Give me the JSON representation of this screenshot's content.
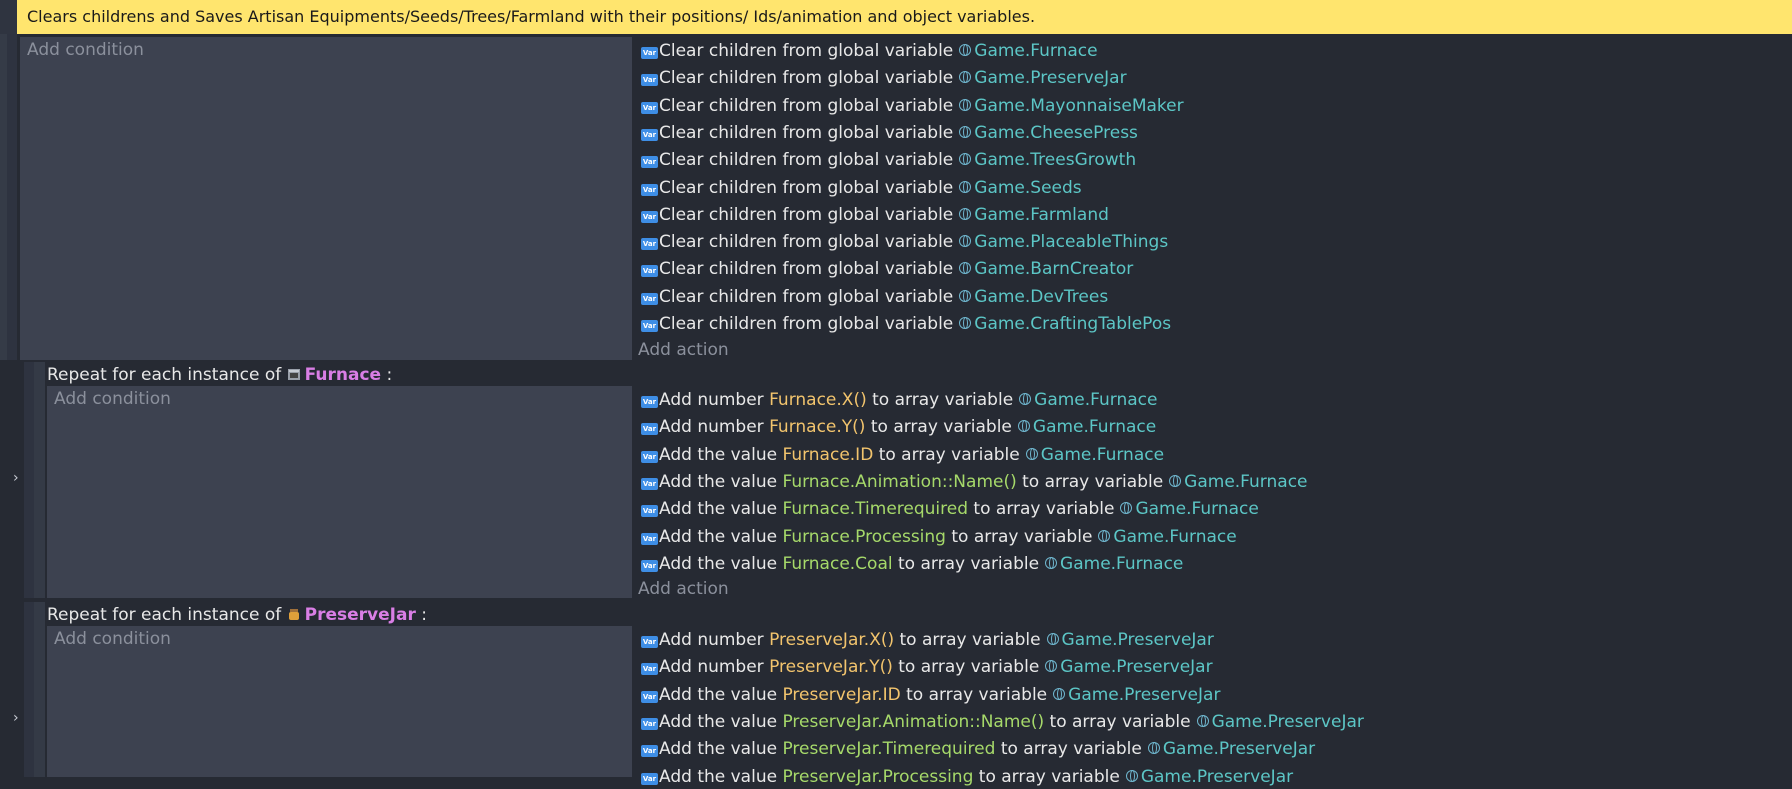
{
  "comment": "Clears childrens and Saves Artisan  Equipments/Seeds/Trees/Farmland with their positions/ Ids/animation and object variables.",
  "add_condition": "Add condition",
  "add_action": "Add action",
  "clear_prefix": "Clear children from global variable",
  "var_icon_text": "Var",
  "clear_actions": [
    "Game.Furnace",
    "Game.PreserveJar",
    "Game.MayonnaiseMaker",
    "Game.CheesePress",
    "Game.TreesGrowth",
    "Game.Seeds",
    "Game.Farmland",
    "Game.PlaceableThings",
    "Game.BarnCreator",
    "Game.DevTrees",
    "Game.CraftingTablePos"
  ],
  "repeat_prefix": "Repeat for each instance of",
  "repeat_suffix": ":",
  "to_array": "to array variable",
  "add_number": "Add number",
  "add_value": "Add the value",
  "furnace": {
    "object": "Furnace",
    "target": "Game.Furnace",
    "actions": [
      {
        "verb": "Add number",
        "expr": "Furnace.X()",
        "kind": "y"
      },
      {
        "verb": "Add number",
        "expr": "Furnace.Y()",
        "kind": "y"
      },
      {
        "verb": "Add the value",
        "expr": "Furnace.ID",
        "kind": "y"
      },
      {
        "verb": "Add the value",
        "expr": "Furnace.Animation::Name()",
        "kind": "g"
      },
      {
        "verb": "Add the value",
        "expr": "Furnace.Timerequired",
        "kind": "g"
      },
      {
        "verb": "Add the value",
        "expr": "Furnace.Processing",
        "kind": "g"
      },
      {
        "verb": "Add the value",
        "expr": "Furnace.Coal",
        "kind": "g"
      }
    ]
  },
  "preservejar": {
    "object": "PreserveJar",
    "target": "Game.PreserveJar",
    "actions": [
      {
        "verb": "Add number",
        "expr": "PreserveJar.X()",
        "kind": "y"
      },
      {
        "verb": "Add number",
        "expr": "PreserveJar.Y()",
        "kind": "y"
      },
      {
        "verb": "Add the value",
        "expr": "PreserveJar.ID",
        "kind": "y"
      },
      {
        "verb": "Add the value",
        "expr": "PreserveJar.Animation::Name()",
        "kind": "g"
      },
      {
        "verb": "Add the value",
        "expr": "PreserveJar.Timerequired",
        "kind": "g"
      },
      {
        "verb": "Add the value",
        "expr": "PreserveJar.Processing",
        "kind": "g"
      }
    ]
  },
  "colors": {
    "comment_bg": "#ffe56e",
    "object": "#d97ee5",
    "global_var": "#5cc6c6",
    "expr_number": "#f2c46d",
    "expr_string": "#a6d96a"
  }
}
